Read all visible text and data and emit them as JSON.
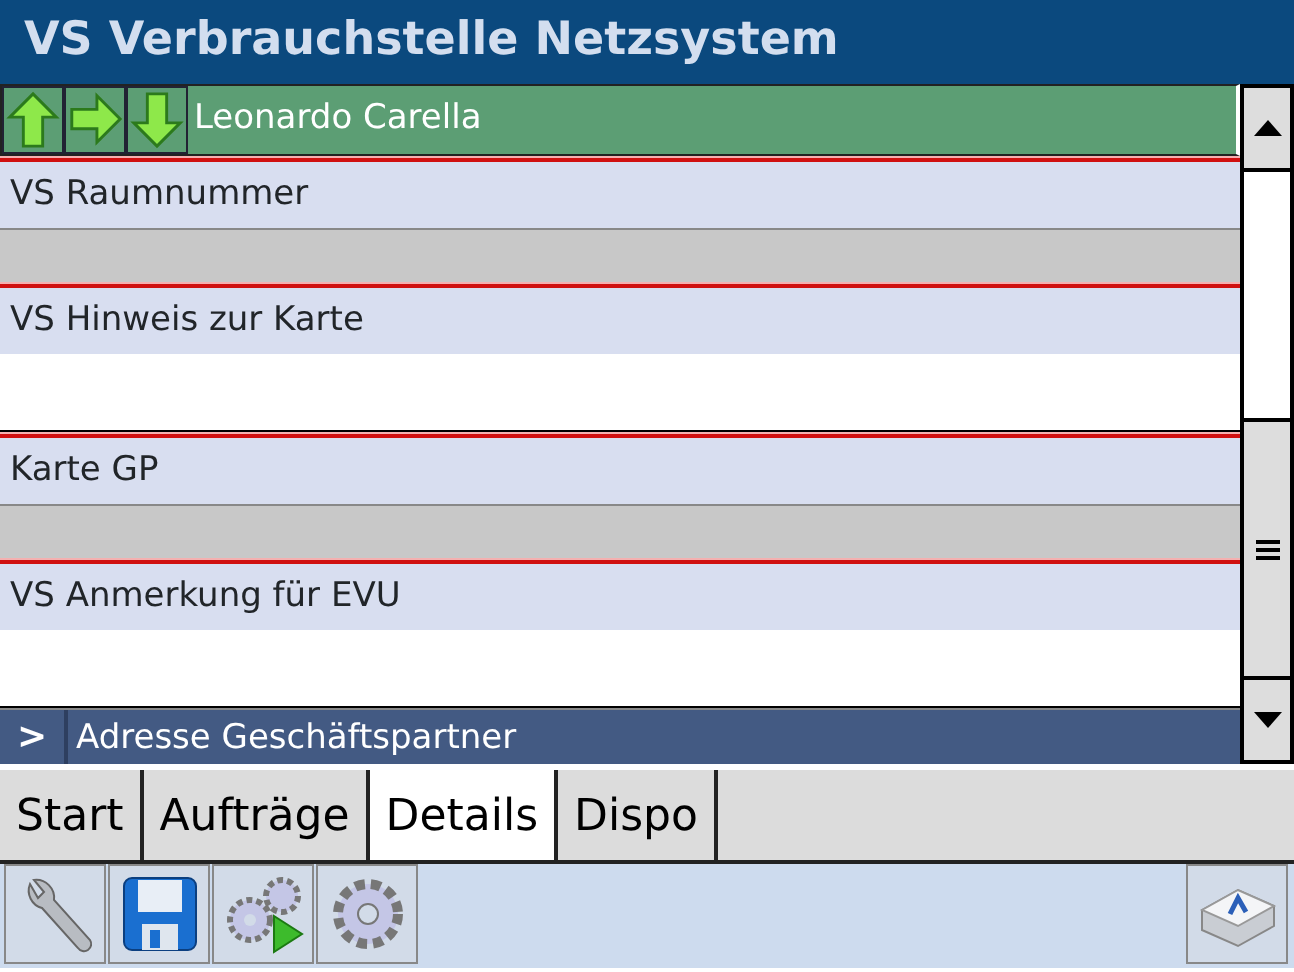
{
  "window": {
    "title": "VS Verbrauchstelle Netzsystem"
  },
  "record": {
    "name": "Leonardo Carella"
  },
  "fields": [
    {
      "label": "VS Raumnummer",
      "disabled": true
    },
    {
      "label": "VS Hinweis zur Karte",
      "disabled": false
    },
    {
      "label": "Karte GP",
      "disabled": true
    },
    {
      "label": "VS Anmerkung für EVU",
      "disabled": false
    }
  ],
  "section": {
    "expander": ">",
    "label": "Adresse Geschäftspartner"
  },
  "tabs": [
    {
      "label": "Start",
      "selected": false
    },
    {
      "label": "Aufträge",
      "selected": false
    },
    {
      "label": "Details",
      "selected": true
    },
    {
      "label": "Dispo",
      "selected": false
    }
  ],
  "toolbar": [
    {
      "kind": "wrench"
    },
    {
      "kind": "save"
    },
    {
      "kind": "run"
    },
    {
      "kind": "gear"
    }
  ]
}
